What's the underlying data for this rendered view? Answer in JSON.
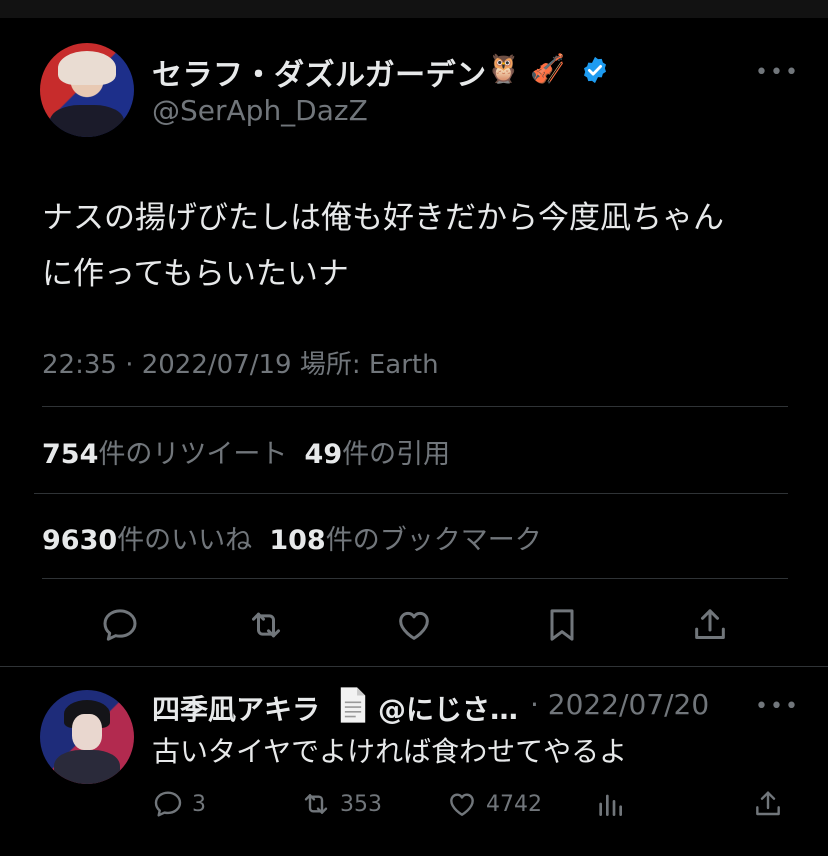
{
  "main_tweet": {
    "display_name": "セラフ・ダズルガーデン",
    "emojis": [
      "🦉",
      "🎻"
    ],
    "handle": "@SerAph_DazZ",
    "text_line1": "ナスの揚げびたしは俺も好きだから今度凪ちゃん",
    "text_line2": "に作ってもらいたいナ",
    "meta": "22:35 · 2022/07/19 場所: Earth",
    "retweets": "754",
    "retweets_label": "件のリツイート",
    "quotes": "49",
    "quotes_label": "件の引用",
    "likes": "9630",
    "likes_label": "件のいいね",
    "bookmarks": "108",
    "bookmarks_label": "件のブックマーク"
  },
  "reply": {
    "display_name": "四季凪アキラ",
    "handle": "@にじさ…",
    "date": "· 2022/07/20",
    "text": "古いタイヤでよければ食わせてやるよ",
    "replies": "3",
    "retweets": "353",
    "likes": "4742"
  },
  "more_label": "•••",
  "colors": {
    "background": "#000000",
    "text": "#e7e9ea",
    "muted": "#71767b",
    "divider": "#2f3336",
    "verified": "#1d9bf0"
  }
}
